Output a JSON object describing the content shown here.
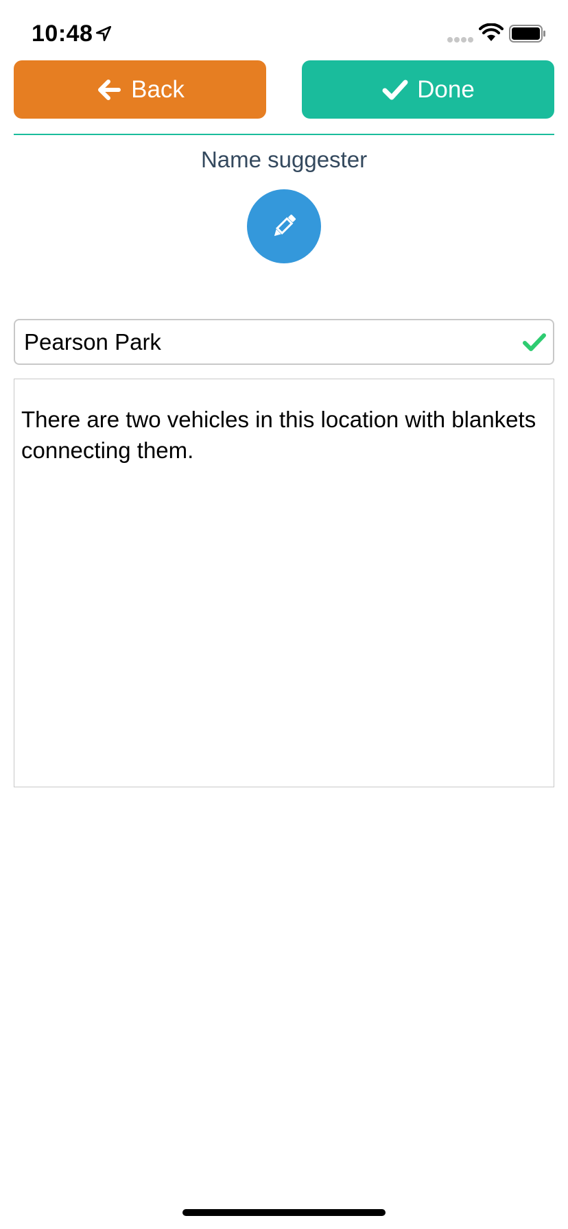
{
  "status_bar": {
    "time": "10:48"
  },
  "toolbar": {
    "back_label": "Back",
    "done_label": "Done"
  },
  "header": {
    "title": "Name suggester"
  },
  "form": {
    "name_value": "Pearson Park",
    "description_value": "There are two vehicles in this location with blankets connecting them."
  },
  "colors": {
    "back_button": "#e67e22",
    "done_button": "#1abc9c",
    "edit_button": "#3498db",
    "valid_check": "#2ecc71",
    "title_text": "#34495e"
  },
  "icons": {
    "back": "arrow-left-icon",
    "done": "check-icon",
    "edit": "pencil-icon",
    "valid": "check-icon"
  }
}
